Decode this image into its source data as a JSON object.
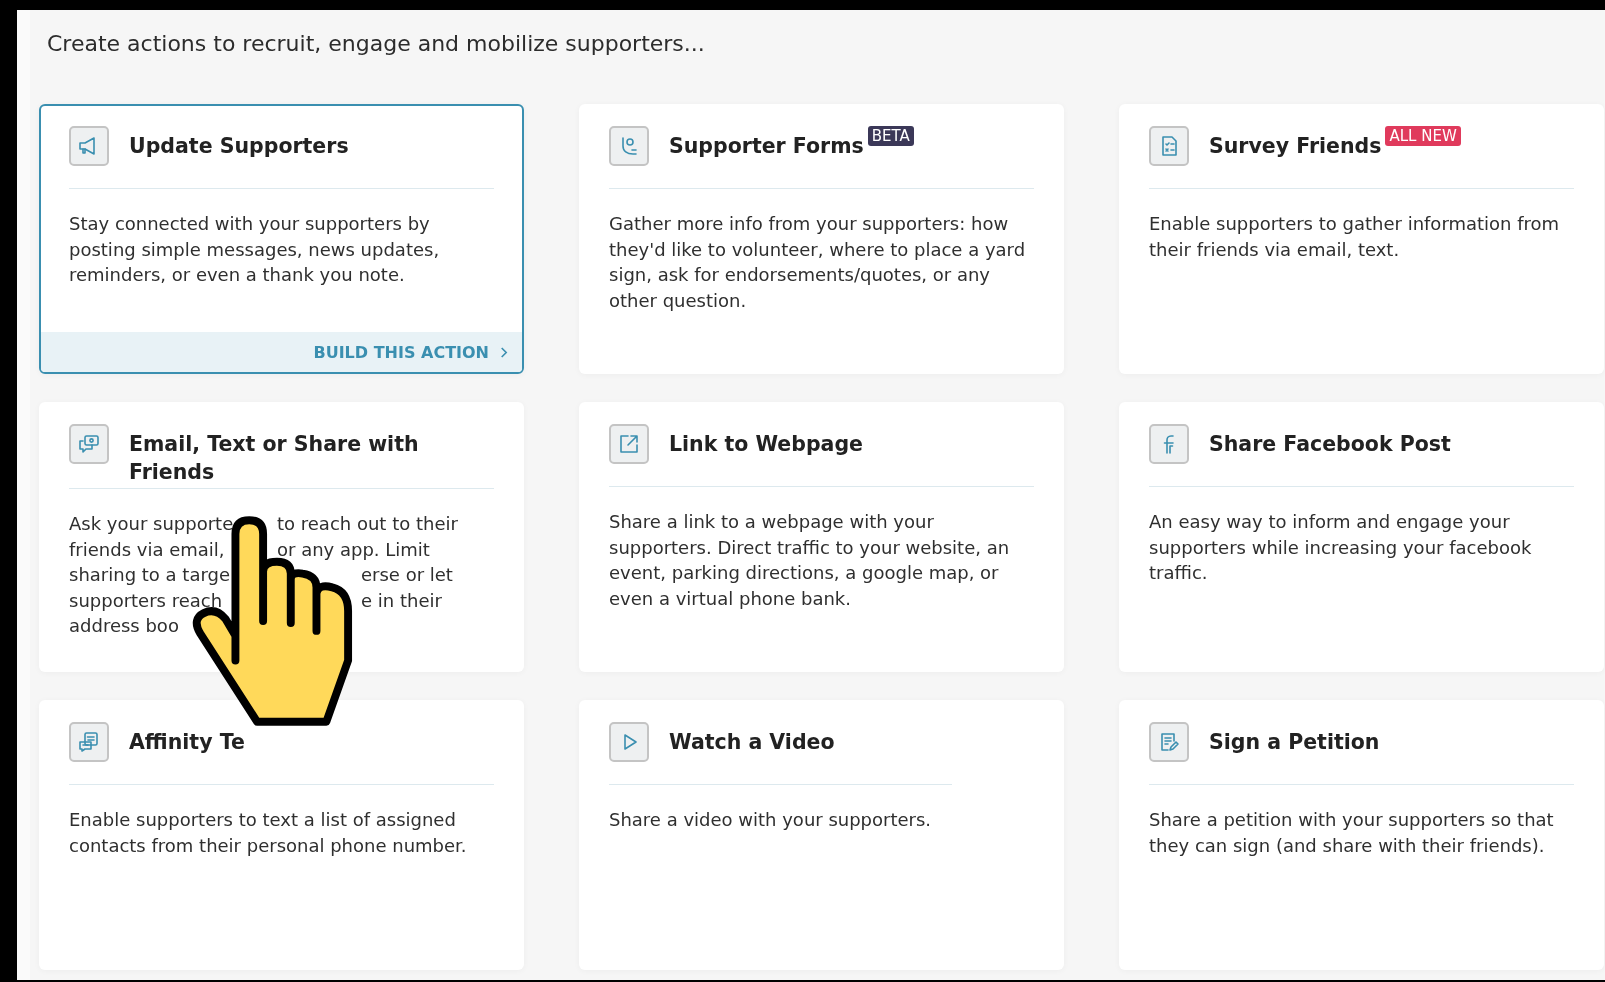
{
  "heading": "Create actions to recruit, engage and mobilize supporters...",
  "cards": [
    {
      "kind": "megaphone",
      "title": "Update Supporters",
      "selected": true,
      "description": "Stay connected with your supporters by posting simple messages, news updates, reminders, or even a thank you note.",
      "action_label": "BUILD THIS ACTION"
    },
    {
      "kind": "form",
      "title": "Supporter Forms",
      "selected": false,
      "badge": {
        "text": "BETA",
        "color": "#3b3858"
      },
      "description": "Gather more info from your supporters: how they'd like to volunteer, where to place a yard sign, ask for endorsements/quotes, or any other question."
    },
    {
      "kind": "survey",
      "title": "Survey Friends",
      "selected": false,
      "badge": {
        "text": "ALL NEW",
        "color": "#e03a5c"
      },
      "description": "Enable supporters to gather information from their friends via email, text."
    },
    {
      "kind": "chat",
      "title": "Email, Text or Share with Friends",
      "selected": false,
      "description_lines": [
        [
          "Ask your supporte",
          "to reach out to their"
        ],
        [
          "friends via email,",
          "or any app. Limit"
        ],
        [
          "sharing to a targe",
          "erse or let"
        ],
        [
          "supporters reach",
          "e in their"
        ],
        [
          "address boo"
        ]
      ]
    },
    {
      "kind": "link",
      "title": "Link to Webpage",
      "selected": false,
      "description": "Share a link to a webpage with your supporters. Direct traffic to your website, an event, parking directions, a google map, or even a virtual phone bank."
    },
    {
      "kind": "facebook",
      "title": "Share Facebook Post",
      "selected": false,
      "description": "An easy way to inform and engage your supporters while increasing your facebook traffic."
    },
    {
      "kind": "texting",
      "title": "Affinity Te",
      "selected": false,
      "description": "Enable supporters to text a list of assigned contacts from their personal phone number."
    },
    {
      "kind": "video",
      "title": "Watch a Video",
      "selected": false,
      "description": "Share a video with your supporters."
    },
    {
      "kind": "petition",
      "title": "Sign a Petition",
      "selected": false,
      "description": "Share a petition with your supporters so that they can sign (and share with their friends)."
    }
  ]
}
